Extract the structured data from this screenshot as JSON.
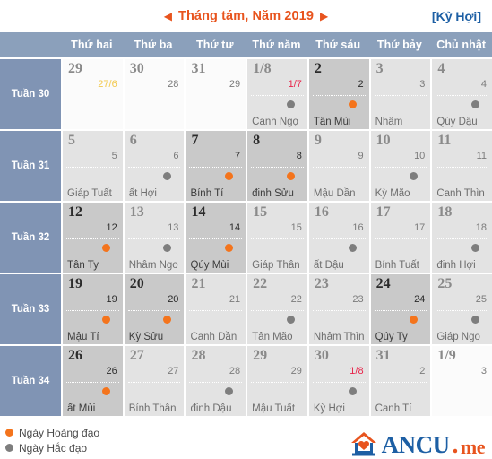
{
  "header": {
    "prev_arrow": "◀",
    "next_arrow": "▶",
    "month_title": "Tháng tám, Năm 2019",
    "zodiac_year": "[Kỷ Hợi]"
  },
  "weekdays": [
    "Thứ hai",
    "Thứ ba",
    "Thứ tư",
    "Thứ năm",
    "Thứ sáu",
    "Thứ bảy",
    "Chủ nhật"
  ],
  "colors": {
    "accent_orange": "#e8541e",
    "brand_blue": "#1d5fa4",
    "header_bar": "#8ba0bb",
    "week_label": "#8094b4",
    "good_day_dot": "#f4741c",
    "bad_day_dot": "#7e7e7e",
    "lunar_red": "#e8244a",
    "lunar_yellow": "#f2c84b"
  },
  "weeks": [
    {
      "label": "Tuần 30",
      "days": [
        {
          "solar": "29",
          "lunar": "27/6",
          "candi": "",
          "dot": "none",
          "bg": "othermonth",
          "solar_style": "gray",
          "lunar_style": "yellow"
        },
        {
          "solar": "30",
          "lunar": "28",
          "candi": "",
          "dot": "none",
          "bg": "othermonth",
          "solar_style": "gray",
          "lunar_style": ""
        },
        {
          "solar": "31",
          "lunar": "29",
          "candi": "",
          "dot": "none",
          "bg": "othermonth",
          "solar_style": "gray",
          "lunar_style": ""
        },
        {
          "solar": "1/8",
          "lunar": "1/7",
          "candi": "Canh Ngọ",
          "dot": "bad",
          "bg": "normal",
          "solar_style": "gray",
          "lunar_style": "red"
        },
        {
          "solar": "2",
          "lunar": "2",
          "candi": "Tân Mùi",
          "dot": "good",
          "bg": "shade",
          "solar_style": "dark",
          "lunar_style": "dark"
        },
        {
          "solar": "3",
          "lunar": "3",
          "candi": "Nhâm",
          "dot": "none",
          "bg": "normal",
          "solar_style": "gray",
          "lunar_style": ""
        },
        {
          "solar": "4",
          "lunar": "4",
          "candi": "Qúy Dậu",
          "dot": "bad",
          "bg": "normal",
          "solar_style": "gray",
          "lunar_style": ""
        }
      ]
    },
    {
      "label": "Tuần 31",
      "days": [
        {
          "solar": "5",
          "lunar": "5",
          "candi": "Giáp Tuất",
          "dot": "none",
          "bg": "normal",
          "solar_style": "gray",
          "lunar_style": ""
        },
        {
          "solar": "6",
          "lunar": "6",
          "candi": "ất Hợi",
          "dot": "bad",
          "bg": "normal",
          "solar_style": "gray",
          "lunar_style": ""
        },
        {
          "solar": "7",
          "lunar": "7",
          "candi": "Bính Tí",
          "dot": "good",
          "bg": "shade",
          "solar_style": "dark",
          "lunar_style": "dark"
        },
        {
          "solar": "8",
          "lunar": "8",
          "candi": "đinh Sửu",
          "dot": "good",
          "bg": "shade",
          "solar_style": "dark",
          "lunar_style": "dark"
        },
        {
          "solar": "9",
          "lunar": "9",
          "candi": "Mậu Dần",
          "dot": "none",
          "bg": "normal",
          "solar_style": "gray",
          "lunar_style": ""
        },
        {
          "solar": "10",
          "lunar": "10",
          "candi": "Kỳ Mão",
          "dot": "bad",
          "bg": "normal",
          "solar_style": "gray",
          "lunar_style": ""
        },
        {
          "solar": "11",
          "lunar": "11",
          "candi": "Canh Thìn",
          "dot": "none",
          "bg": "normal",
          "solar_style": "gray",
          "lunar_style": ""
        }
      ]
    },
    {
      "label": "Tuần 32",
      "days": [
        {
          "solar": "12",
          "lunar": "12",
          "candi": "Tân Ty",
          "dot": "good",
          "bg": "shade",
          "solar_style": "dark",
          "lunar_style": "dark"
        },
        {
          "solar": "13",
          "lunar": "13",
          "candi": "Nhâm Ngo",
          "dot": "bad",
          "bg": "normal",
          "solar_style": "gray",
          "lunar_style": ""
        },
        {
          "solar": "14",
          "lunar": "14",
          "candi": "Qúy Mùi",
          "dot": "good",
          "bg": "shade",
          "solar_style": "dark",
          "lunar_style": "dark"
        },
        {
          "solar": "15",
          "lunar": "15",
          "candi": "Giáp Thân",
          "dot": "none",
          "bg": "normal",
          "solar_style": "gray",
          "lunar_style": ""
        },
        {
          "solar": "16",
          "lunar": "16",
          "candi": "ất Dậu",
          "dot": "bad",
          "bg": "normal",
          "solar_style": "gray",
          "lunar_style": ""
        },
        {
          "solar": "17",
          "lunar": "17",
          "candi": "Bính Tuất",
          "dot": "none",
          "bg": "normal",
          "solar_style": "gray",
          "lunar_style": ""
        },
        {
          "solar": "18",
          "lunar": "18",
          "candi": "đinh Hợi",
          "dot": "bad",
          "bg": "normal",
          "solar_style": "gray",
          "lunar_style": ""
        }
      ]
    },
    {
      "label": "Tuần 33",
      "days": [
        {
          "solar": "19",
          "lunar": "19",
          "candi": "Mậu Tí",
          "dot": "good",
          "bg": "shade",
          "solar_style": "dark",
          "lunar_style": "dark"
        },
        {
          "solar": "20",
          "lunar": "20",
          "candi": "Kỳ Sửu",
          "dot": "good",
          "bg": "shade",
          "solar_style": "dark",
          "lunar_style": "dark"
        },
        {
          "solar": "21",
          "lunar": "21",
          "candi": "Canh Dần",
          "dot": "none",
          "bg": "normal",
          "solar_style": "gray",
          "lunar_style": ""
        },
        {
          "solar": "22",
          "lunar": "22",
          "candi": "Tân Mão",
          "dot": "bad",
          "bg": "normal",
          "solar_style": "gray",
          "lunar_style": ""
        },
        {
          "solar": "23",
          "lunar": "23",
          "candi": "Nhâm Thìn",
          "dot": "none",
          "bg": "normal",
          "solar_style": "gray",
          "lunar_style": ""
        },
        {
          "solar": "24",
          "lunar": "24",
          "candi": "Qúy Ty",
          "dot": "good",
          "bg": "shade",
          "solar_style": "dark",
          "lunar_style": "dark"
        },
        {
          "solar": "25",
          "lunar": "25",
          "candi": "Giáp Ngo",
          "dot": "bad",
          "bg": "normal",
          "solar_style": "gray",
          "lunar_style": ""
        }
      ]
    },
    {
      "label": "Tuần 34",
      "days": [
        {
          "solar": "26",
          "lunar": "26",
          "candi": "ất Mùi",
          "dot": "good",
          "bg": "shade",
          "solar_style": "dark",
          "lunar_style": "dark"
        },
        {
          "solar": "27",
          "lunar": "27",
          "candi": "Bính Thân",
          "dot": "none",
          "bg": "normal",
          "solar_style": "gray",
          "lunar_style": ""
        },
        {
          "solar": "28",
          "lunar": "28",
          "candi": "đinh Dậu",
          "dot": "bad",
          "bg": "normal",
          "solar_style": "gray",
          "lunar_style": ""
        },
        {
          "solar": "29",
          "lunar": "29",
          "candi": "Mậu Tuất",
          "dot": "none",
          "bg": "normal",
          "solar_style": "gray",
          "lunar_style": ""
        },
        {
          "solar": "30",
          "lunar": "1/8",
          "candi": "Kỳ Hợi",
          "dot": "bad",
          "bg": "normal",
          "solar_style": "gray",
          "lunar_style": "red"
        },
        {
          "solar": "31",
          "lunar": "2",
          "candi": "Canh Tí",
          "dot": "none",
          "bg": "normal",
          "solar_style": "gray",
          "lunar_style": ""
        },
        {
          "solar": "1/9",
          "lunar": "3",
          "candi": "",
          "dot": "none",
          "bg": "othermonth",
          "solar_style": "gray",
          "lunar_style": ""
        }
      ]
    }
  ],
  "legend": [
    {
      "type": "good",
      "label": "Ngày Hoàng đạo"
    },
    {
      "type": "bad",
      "label": "Ngày Hắc đạo"
    }
  ],
  "logo": {
    "name": "ANCU",
    "dot": ".",
    "tld": "me"
  }
}
